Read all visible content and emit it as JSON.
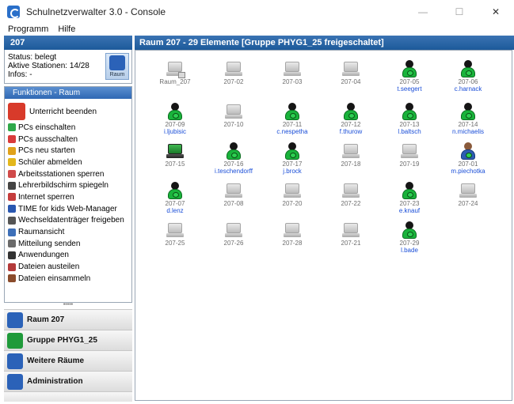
{
  "window": {
    "title": "Schulnetzverwalter 3.0 - Console",
    "controls": {
      "minimize": "—",
      "maximize": "☐",
      "close": "✕"
    }
  },
  "menu": [
    "Programm",
    "Hilfe"
  ],
  "left": {
    "header": "207",
    "status": {
      "line1": "Status: belegt",
      "line2": "Aktive Stationen: 14/28",
      "line3": "Infos: -",
      "room_button_label": "Raum"
    },
    "functions_title": "Funktionen - Raum",
    "functions": [
      {
        "label": "Unterricht beenden",
        "icon": "stop-lesson-icon",
        "color": "#d83a2a"
      },
      {
        "label": "PCs einschalten",
        "icon": "power-on-icon",
        "color": "#2fa84a"
      },
      {
        "label": "PCs ausschalten",
        "icon": "power-off-icon",
        "color": "#d93b3b"
      },
      {
        "label": "PCs neu starten",
        "icon": "restart-icon",
        "color": "#e0a21b"
      },
      {
        "label": "Schüler abmelden",
        "icon": "logout-icon",
        "color": "#e3b71c"
      },
      {
        "label": "Arbeitsstationen sperren",
        "icon": "lock-stations-icon",
        "color": "#d04a4a"
      },
      {
        "label": "Lehrerbildschirm spiegeln",
        "icon": "mirror-screen-icon",
        "color": "#444444"
      },
      {
        "label": "Internet sperren",
        "icon": "block-internet-icon",
        "color": "#c53d3d"
      },
      {
        "label": "TIME for kids Web-Manager",
        "icon": "web-manager-icon",
        "color": "#2957b0"
      },
      {
        "label": "Wechseldatenträger freigeben",
        "icon": "removable-media-icon",
        "color": "#555555"
      },
      {
        "label": "Raumansicht",
        "icon": "room-view-icon",
        "color": "#3d6fb8"
      },
      {
        "label": "Mitteilung senden",
        "icon": "message-icon",
        "color": "#6a6a6a"
      },
      {
        "label": "Anwendungen",
        "icon": "applications-icon",
        "color": "#333333"
      },
      {
        "label": "Dateien austeilen",
        "icon": "distribute-files-icon",
        "color": "#b33a3a"
      },
      {
        "label": "Dateien einsammeln",
        "icon": "collect-files-icon",
        "color": "#8a4b2b"
      }
    ],
    "splitter": "•••••",
    "nav": [
      {
        "label": "Raum 207",
        "icon": "room-icon",
        "color": "#2b62b8"
      },
      {
        "label": "Gruppe PHYG1_25",
        "icon": "group-icon",
        "color": "#1f9a3a"
      },
      {
        "label": "Weitere Räume",
        "icon": "more-rooms-icon",
        "color": "#2b62b8"
      },
      {
        "label": "Administration",
        "icon": "administration-icon",
        "color": "#2b62b8"
      }
    ]
  },
  "right": {
    "header": "Raum 207 - 29 Elemente [Gruppe PHYG1_25 freigeschaltet]",
    "stations": [
      {
        "id": "Raum_207",
        "user": "",
        "state": "printer"
      },
      {
        "id": "207-02",
        "user": "",
        "state": "off"
      },
      {
        "id": "207-03",
        "user": "",
        "state": "off"
      },
      {
        "id": "207-04",
        "user": "",
        "state": "off"
      },
      {
        "id": "207-05",
        "user": "t.seegert",
        "state": "user"
      },
      {
        "id": "207-06",
        "user": "c.harnack",
        "state": "user"
      },
      {
        "id": "207-09",
        "user": "i.ljubisic",
        "state": "user"
      },
      {
        "id": "207-10",
        "user": "",
        "state": "off"
      },
      {
        "id": "207-11",
        "user": "c.nespetha",
        "state": "user"
      },
      {
        "id": "207-12",
        "user": "f.thurow",
        "state": "user"
      },
      {
        "id": "207-13",
        "user": "l.baltsch",
        "state": "user"
      },
      {
        "id": "207-14",
        "user": "n.michaelis",
        "state": "user"
      },
      {
        "id": "207-15",
        "user": "",
        "state": "on"
      },
      {
        "id": "207-16",
        "user": "i.teschendorff",
        "state": "user"
      },
      {
        "id": "207-17",
        "user": "j.brock",
        "state": "user"
      },
      {
        "id": "207-18",
        "user": "",
        "state": "off"
      },
      {
        "id": "207-19",
        "user": "",
        "state": "off"
      },
      {
        "id": "207-01",
        "user": "m.piechotka",
        "state": "teacher"
      },
      {
        "id": "207-07",
        "user": "d.lenz",
        "state": "user"
      },
      {
        "id": "207-08",
        "user": "",
        "state": "off"
      },
      {
        "id": "207-20",
        "user": "",
        "state": "off"
      },
      {
        "id": "207-22",
        "user": "",
        "state": "off"
      },
      {
        "id": "207-23",
        "user": "e.knauf",
        "state": "user"
      },
      {
        "id": "207-24",
        "user": "",
        "state": "off"
      },
      {
        "id": "207-25",
        "user": "",
        "state": "off"
      },
      {
        "id": "207-26",
        "user": "",
        "state": "off"
      },
      {
        "id": "207-28",
        "user": "",
        "state": "off"
      },
      {
        "id": "207-21",
        "user": "",
        "state": "off"
      },
      {
        "id": "207-29",
        "user": "l.bade",
        "state": "user"
      }
    ]
  }
}
